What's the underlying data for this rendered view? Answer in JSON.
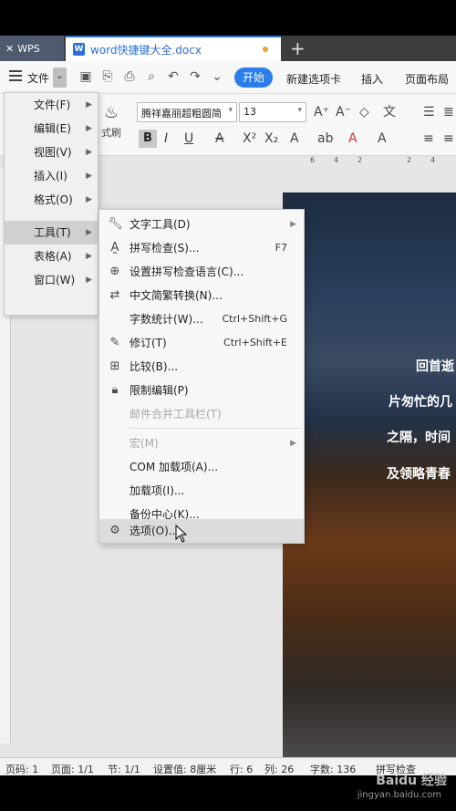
{
  "titlebar": {
    "wps_tab": "WPS",
    "doc_tab": "word快捷键大全.docx",
    "add_tab": "+"
  },
  "menubar": {
    "file_label": "文件",
    "start_label": "开始",
    "tabs": [
      "新建选项卡",
      "插入",
      "页面布局"
    ]
  },
  "ribbon": {
    "font_name": "腾祥嘉丽超粗圆简",
    "font_size": "13",
    "format_painter": "式刷"
  },
  "ruler": [
    "6",
    "4",
    "2",
    "2",
    "4"
  ],
  "menu1": {
    "items": [
      {
        "label": "文件(F)"
      },
      {
        "label": "编辑(E)"
      },
      {
        "label": "视图(V)"
      },
      {
        "label": "插入(I)"
      },
      {
        "label": "格式(O)"
      },
      {
        "label": "工具(T)"
      },
      {
        "label": "表格(A)"
      },
      {
        "label": "窗口(W)"
      }
    ]
  },
  "menu2": {
    "items": [
      {
        "label": "文字工具(D)",
        "shortcut": ""
      },
      {
        "label": "拼写检查(S)...",
        "shortcut": "F7"
      },
      {
        "label": "设置拼写检查语言(C)...",
        "shortcut": ""
      },
      {
        "label": "中文简繁转换(N)...",
        "shortcut": ""
      },
      {
        "label": "字数统计(W)...",
        "shortcut": "Ctrl+Shift+G"
      },
      {
        "label": "修订(T)",
        "shortcut": "Ctrl+Shift+E"
      },
      {
        "label": "比较(B)...",
        "shortcut": ""
      },
      {
        "label": "限制编辑(P)",
        "shortcut": ""
      },
      {
        "label": "邮件合并工具栏(T)",
        "shortcut": ""
      },
      {
        "label": "宏(M)",
        "shortcut": ""
      },
      {
        "label": "COM 加载项(A)...",
        "shortcut": ""
      },
      {
        "label": "加载项(I)...",
        "shortcut": ""
      },
      {
        "label": "备份中心(K)...",
        "shortcut": ""
      },
      {
        "label": "选项(O)...",
        "shortcut": ""
      }
    ]
  },
  "document": {
    "lines": [
      "回首逝",
      "片匆忙的几",
      "之隔，时间",
      "及领略青春"
    ]
  },
  "statusbar": {
    "page_code": "页码: 1",
    "page": "页面: 1/1",
    "section": "节: 1/1",
    "setting": "设置值: 8厘米",
    "row": "行: 6",
    "col": "列: 26",
    "words": "字数: 136",
    "spell": "拼写检查"
  },
  "watermark": {
    "brand": "Baidu 经验",
    "url": "jingyan.baidu.com"
  },
  "colors": {
    "accent": "#2b7de9",
    "doc_tab_blue": "#2b6fd6"
  }
}
